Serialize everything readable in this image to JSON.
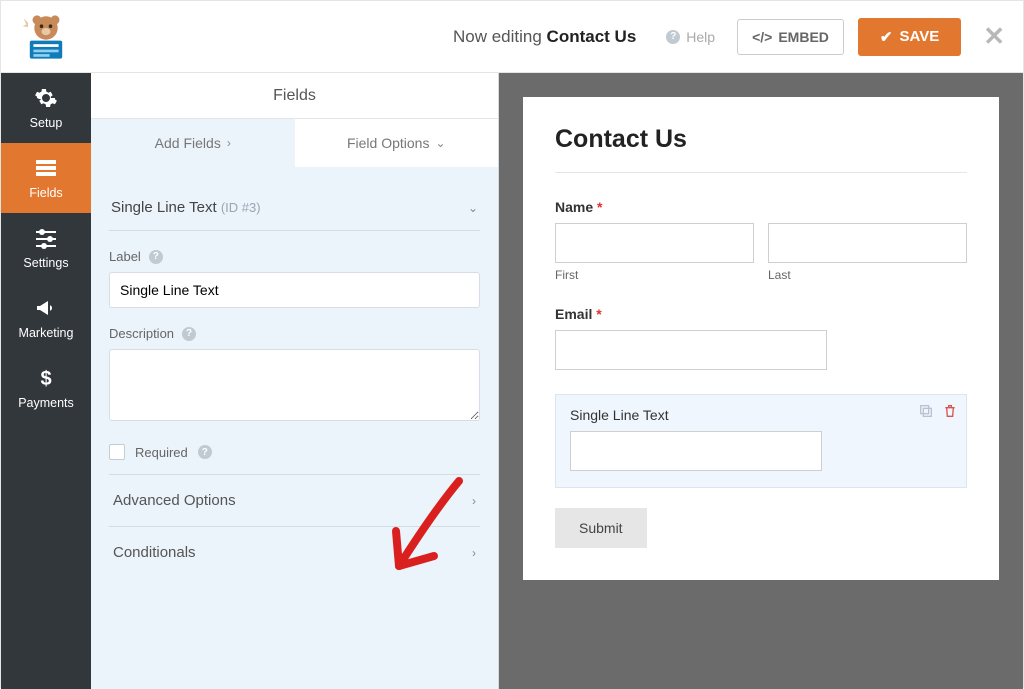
{
  "header": {
    "now_editing_prefix": "Now editing ",
    "form_name": "Contact Us",
    "help": "Help",
    "embed": "EMBED",
    "save": "SAVE"
  },
  "nav": {
    "setup": "Setup",
    "fields": "Fields",
    "settings": "Settings",
    "marketing": "Marketing",
    "payments": "Payments"
  },
  "panel": {
    "title": "Fields",
    "tab_add": "Add Fields",
    "tab_options": "Field Options",
    "field_type": "Single Line Text",
    "field_id": "(ID #3)",
    "label_label": "Label",
    "label_value": "Single Line Text",
    "desc_label": "Description",
    "required": "Required",
    "advanced": "Advanced Options",
    "conditionals": "Conditionals"
  },
  "preview": {
    "title": "Contact Us",
    "name_label": "Name",
    "first": "First",
    "last": "Last",
    "email_label": "Email",
    "slt_label": "Single Line Text",
    "submit": "Submit"
  }
}
